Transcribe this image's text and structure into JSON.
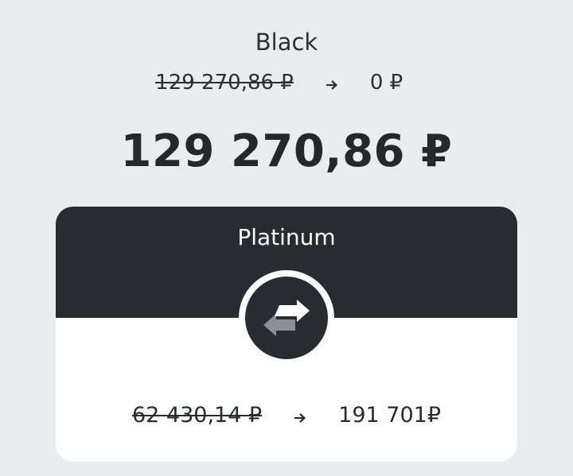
{
  "source_account": {
    "name": "Black",
    "balance_before": "129 270,86 ₽",
    "balance_after": "0 ₽"
  },
  "transfer_amount": "129 270,86 ₽",
  "target_account": {
    "name": "Platinum",
    "balance_before": "62 430,14 ₽",
    "balance_after": "191 701₽"
  },
  "icons": {
    "arrow": "arrow-right-icon",
    "swap": "swap-arrows-icon"
  },
  "colors": {
    "background": "#ebecee",
    "card_dark": "#2a2b30",
    "card_light": "#ffffff"
  }
}
